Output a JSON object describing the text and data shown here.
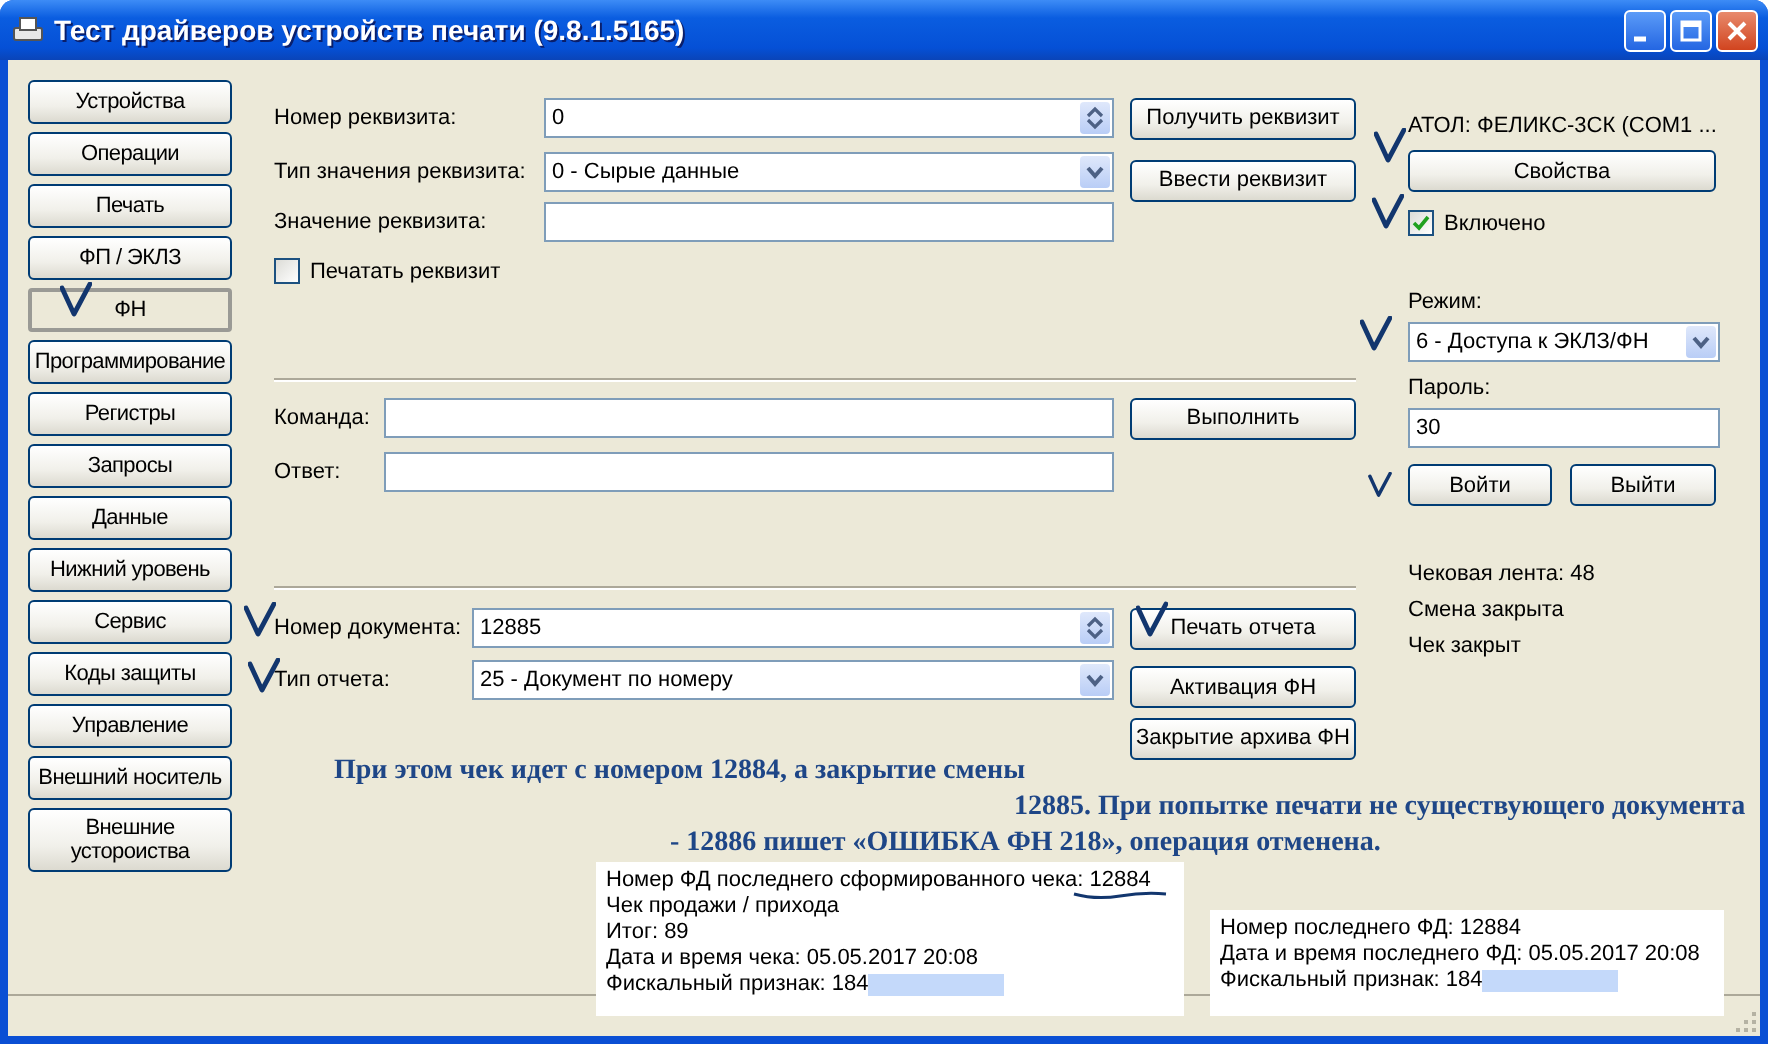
{
  "window": {
    "title": "Тест драйверов устройств печати (9.8.1.5165)"
  },
  "nav": [
    {
      "label": "Устройства",
      "selected": false
    },
    {
      "label": "Операции",
      "selected": false
    },
    {
      "label": "Печать",
      "selected": false
    },
    {
      "label": "ФП / ЭКЛЗ",
      "selected": false
    },
    {
      "label": "ФН",
      "selected": true
    },
    {
      "label": "Программирование",
      "selected": false
    },
    {
      "label": "Регистры",
      "selected": false
    },
    {
      "label": "Запросы",
      "selected": false
    },
    {
      "label": "Данные",
      "selected": false
    },
    {
      "label": "Нижний уровень",
      "selected": false
    },
    {
      "label": "Сервис",
      "selected": false
    },
    {
      "label": "Коды защиты",
      "selected": false
    },
    {
      "label": "Управление",
      "selected": false
    },
    {
      "label": "Внешний носитель",
      "selected": false
    },
    {
      "label": "Внешние устороиства",
      "selected": false
    }
  ],
  "requisite": {
    "number_label": "Номер реквизита:",
    "number_value": "0",
    "type_label": "Тип значения реквизита:",
    "type_value": "0 - Сырые данные",
    "value_label": "Значение реквизита:",
    "print_checkbox": {
      "label": "Печатать реквизит",
      "checked": false
    },
    "get_button": "Получить реквизит",
    "set_button": "Ввести реквизит"
  },
  "command": {
    "command_label": "Команда:",
    "answer_label": "Ответ:",
    "run_button": "Выполнить"
  },
  "report": {
    "doc_label": "Номер документа:",
    "doc_value": "12885",
    "type_label": "Тип отчета:",
    "type_value": "25 - Документ по номеру",
    "buttons": [
      "Печать отчета",
      "Активация ФН",
      "Закрытие архива ФН"
    ]
  },
  "device": {
    "name": "АТОЛ: ФЕЛИКС-3СК (COM1 ...",
    "properties_button": "Свойства",
    "enabled": {
      "label": "Включено",
      "checked": true
    },
    "mode_label": "Режим:",
    "mode_value": "6 - Доступа к ЭКЛЗ/ФН",
    "password_label": "Пароль:",
    "password_value": "30",
    "login_button": "Войти",
    "logout_button": "Выйти",
    "status": [
      "Чековая лента: 48",
      "Смена закрыта",
      "Чек закрыт"
    ]
  },
  "annotation": {
    "lines": [
      "При этом чек идет с номером 12884, а закрытие смены",
      "12885. При попытке печати не существующего документа",
      "- 12886 пишет «ОШИБКА ФН 218», операция отменена."
    ]
  },
  "receipt_info": {
    "lines": [
      {
        "text": "Номер ФД последнего сформированного чека: 12884",
        "redacted": false
      },
      {
        "text": "Чек продажи / прихода",
        "redacted": false
      },
      {
        "text": "Итог: 89",
        "redacted": false
      },
      {
        "text": "Дата и время чека: 05.05.2017 20:08",
        "redacted": false
      },
      {
        "text": "Фискальный признак: 184",
        "redacted": true
      }
    ]
  },
  "last_fd_info": {
    "lines": [
      {
        "text": "Номер последнего ФД: 12884",
        "redacted": false
      },
      {
        "text": "Дата и время последнего ФД: 05.05.2017 20:08",
        "redacted": false
      },
      {
        "text": "Фискальный признак: 184",
        "redacted": true
      }
    ]
  }
}
